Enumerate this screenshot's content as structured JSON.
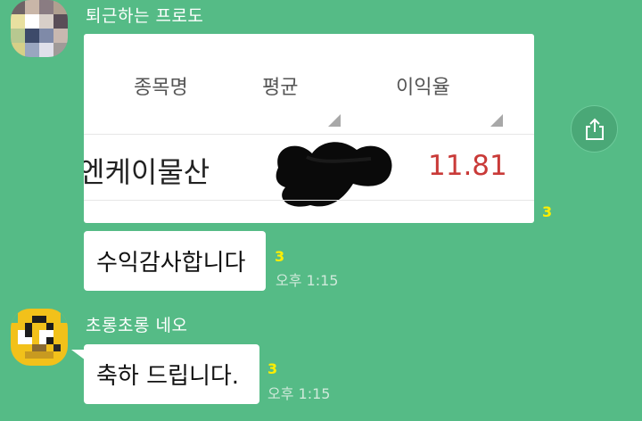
{
  "messages": [
    {
      "sender": "퇴근하는 프로도",
      "avatar_icon": "pixelated-profile-avatar",
      "image_card": {
        "columns": [
          "종목명",
          "평균",
          "이익율"
        ],
        "row": {
          "name": "엔케이물산",
          "average": "",
          "rate": "11.81"
        }
      },
      "image_read_count": "3",
      "text": "수익감사합니다",
      "text_read_count": "3",
      "time": "오후 1:15"
    },
    {
      "sender": "초롱초롱 네오",
      "avatar_icon": "neo-character-avatar",
      "text": "축하 드립니다.",
      "text_read_count": "3",
      "time": "오후 1:15"
    }
  ],
  "share_icon": "share-icon",
  "colors": {
    "background": "#55bb86",
    "rate_red": "#c93a38",
    "read_count_yellow": "#ffee00",
    "bubble": "#ffffff"
  }
}
